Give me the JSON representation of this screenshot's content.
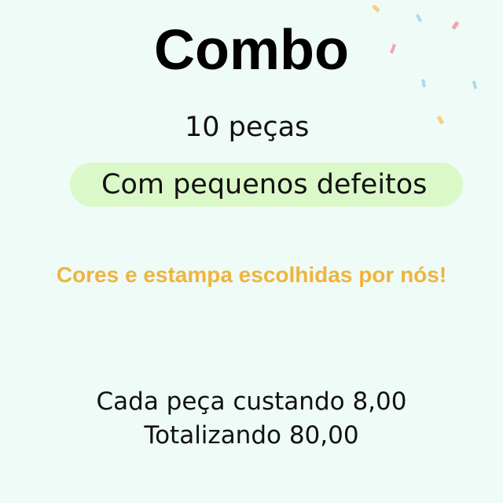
{
  "title": "Combo",
  "quantity": "10 peças",
  "condition_badge": "Com pequenos defeitos",
  "note": "Cores e estampa escolhidas por nós!",
  "price": {
    "line1": "Cada peça custando 8,00",
    "line2": "Totalizando 80,00"
  },
  "colors": {
    "background": "#effbf6",
    "badge": "#dbf8c8",
    "note": "#efb43f",
    "text": "#111111"
  },
  "decoration": "confetti"
}
